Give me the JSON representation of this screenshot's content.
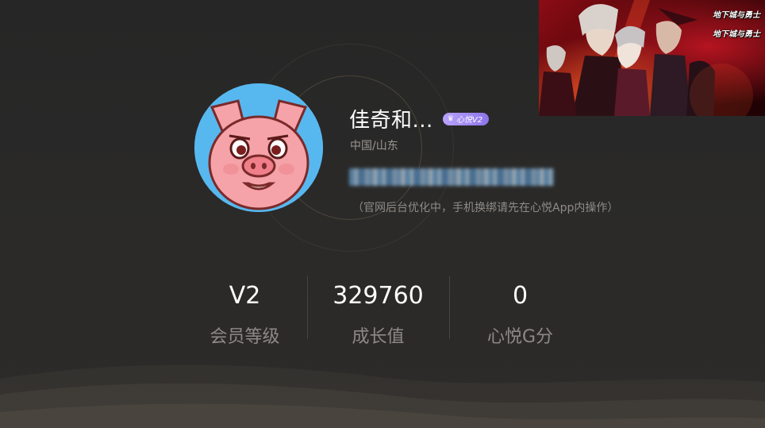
{
  "profile": {
    "name": "佳奇和...",
    "vip_badge": "心悦V2",
    "location": "中国/山东",
    "phone_masked": "",
    "notice": "（官网后台优化中，手机换绑请先在心悦App内操作）"
  },
  "stats": [
    {
      "value": "V2",
      "label": "会员等级"
    },
    {
      "value": "329760",
      "label": "成长值"
    },
    {
      "value": "0",
      "label": "心悦G分"
    }
  ],
  "ad": {
    "logo_text_1": "地下城与勇士",
    "logo_text_2": "地下城与勇士"
  },
  "colors": {
    "background": "#272625",
    "badge": "#a38cf5",
    "muted_text": "#8d8985",
    "avatar_bg": "#57b8f0",
    "pig_pink": "#f5a3a8"
  },
  "icons": {
    "vip": "crown-icon",
    "avatar": "pig-avatar"
  }
}
